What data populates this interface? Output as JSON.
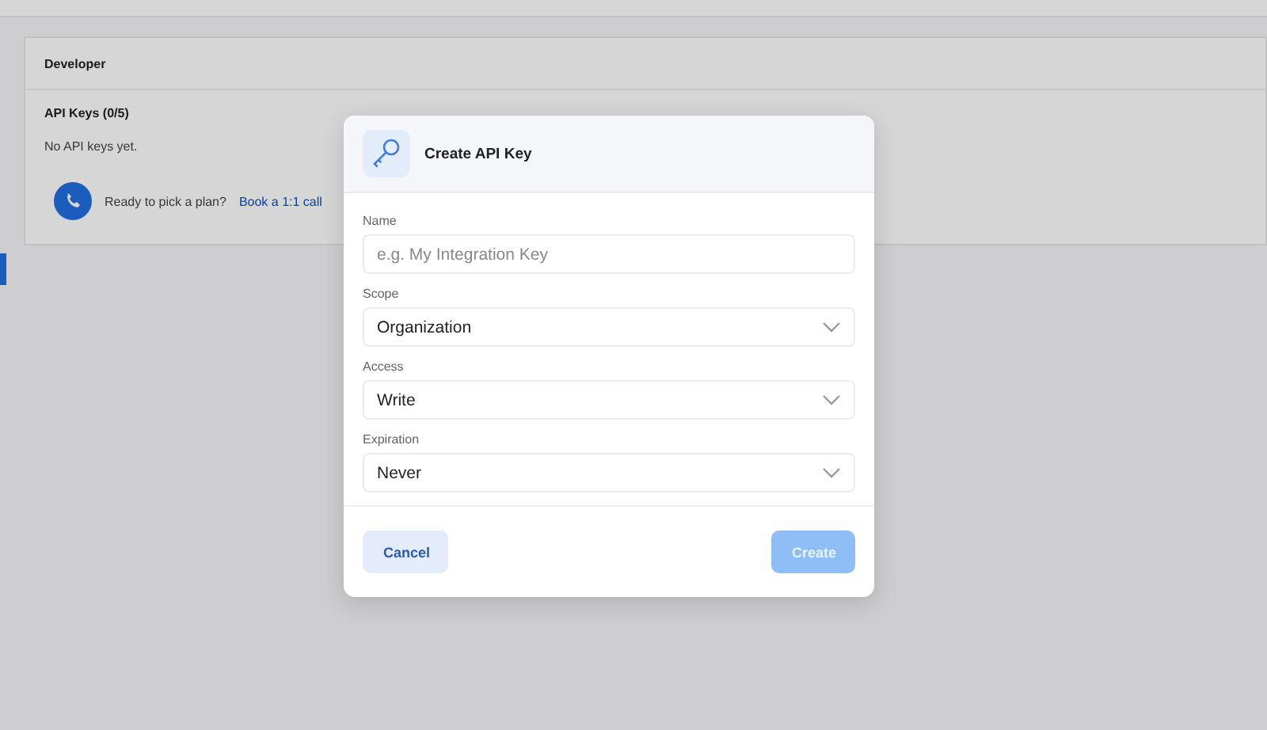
{
  "background": {
    "section_title": "Developer",
    "card_title": "API Keys (0/5)",
    "empty_text": "No API keys yet.",
    "cta_text": "Ready to pick a plan?",
    "cta_link": "Book a 1:1 call"
  },
  "dialog": {
    "title": "Create API Key",
    "fields": [
      {
        "kind": "text",
        "label": "Name",
        "placeholder": "e.g. My Integration Key"
      },
      {
        "kind": "select",
        "label": "Scope",
        "value": "Organization"
      },
      {
        "kind": "select",
        "label": "Access",
        "value": "Write"
      },
      {
        "kind": "select",
        "label": "Expiration",
        "value": "Never"
      }
    ],
    "cancel": {
      "label": "Cancel"
    },
    "create": {
      "label": "Create",
      "disabled": true
    }
  }
}
